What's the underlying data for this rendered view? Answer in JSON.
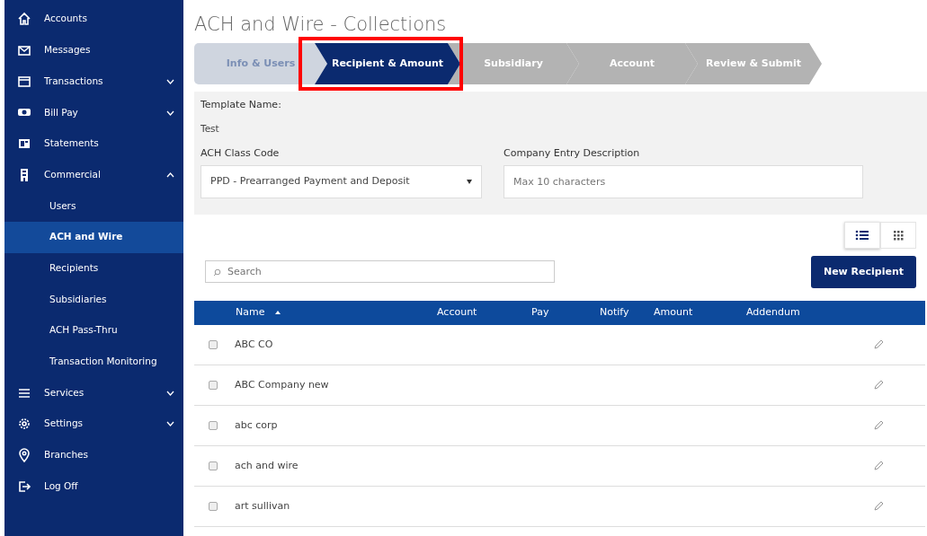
{
  "sidebar": {
    "items": [
      {
        "label": "Accounts",
        "selected": false
      },
      {
        "label": "Messages",
        "selected": false
      },
      {
        "label": "Transactions",
        "selected": false,
        "expanded": false
      },
      {
        "label": "Bill Pay",
        "selected": false,
        "expanded": false
      },
      {
        "label": "Statements",
        "selected": false
      },
      {
        "label": "Commercial",
        "selected": false,
        "expanded": true,
        "children": [
          {
            "label": "Users",
            "selected": false
          },
          {
            "label": "ACH and Wire",
            "selected": true
          },
          {
            "label": "Recipients",
            "selected": false
          },
          {
            "label": "Subsidiaries",
            "selected": false
          },
          {
            "label": "ACH Pass-Thru",
            "selected": false
          },
          {
            "label": "Transaction Monitoring",
            "selected": false
          }
        ]
      },
      {
        "label": "Services",
        "selected": false,
        "expanded": false
      },
      {
        "label": "Settings",
        "selected": false,
        "expanded": false
      },
      {
        "label": "Branches",
        "selected": false
      },
      {
        "label": "Log Off",
        "selected": false
      }
    ]
  },
  "page_title": "ACH and Wire - Collections",
  "steps": [
    {
      "label": "Info & Users",
      "completed": true,
      "selected": false,
      "highlighted": false
    },
    {
      "label": "Recipient & Amount",
      "completed": false,
      "selected": true,
      "highlighted": true
    },
    {
      "label": "Subsidiary",
      "completed": false,
      "selected": false,
      "highlighted": false
    },
    {
      "label": "Account",
      "completed": false,
      "selected": false,
      "highlighted": false
    },
    {
      "label": "Review & Submit",
      "completed": false,
      "selected": false,
      "highlighted": false
    }
  ],
  "form": {
    "template_name_label": "Template Name:",
    "template_name": "Test",
    "class_code_label": "ACH Class Code",
    "class_code": "PPD - Prearranged Payment and Deposit",
    "entry_description_label": "Company Entry Description",
    "entry_description_placeholder": "Max 10 characters"
  },
  "view_toggle": [
    {
      "selected": true
    },
    {
      "selected": false
    }
  ],
  "search": {
    "placeholder": "Search"
  },
  "new_button": "New Recipient",
  "table": {
    "columns": [
      "Name",
      "Account",
      "Pay",
      "Notify",
      "Amount",
      "Addendum"
    ],
    "rows": [
      {
        "name": "ABC CO",
        "checked": false
      },
      {
        "name": "ABC Company new",
        "checked": false
      },
      {
        "name": "abc corp",
        "checked": false
      },
      {
        "name": "ach and wire",
        "checked": false
      },
      {
        "name": "art sullivan",
        "checked": false
      }
    ]
  }
}
